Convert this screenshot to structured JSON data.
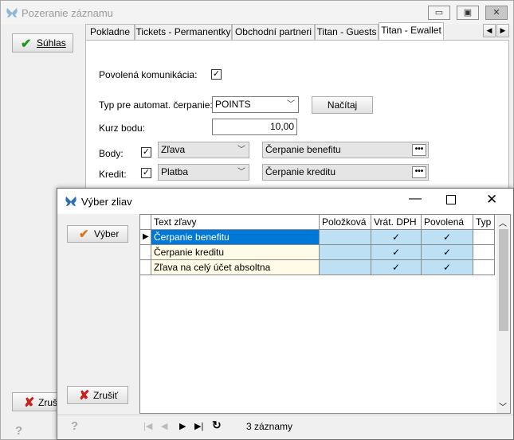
{
  "back": {
    "title": "Pozeranie záznamu",
    "ok_label": "Súhlas",
    "cancel_label": "Zruši",
    "tabs": [
      {
        "label": "Pokladne"
      },
      {
        "label": "Tickets - Permanentky"
      },
      {
        "label": "Obchodní partneri"
      },
      {
        "label": "Titan - Guests"
      },
      {
        "label": "Titan - Ewallet"
      }
    ],
    "form": {
      "allowed_comm_label": "Povolená komunikácia:",
      "type_label": "Typ pre automat. čerpanie:",
      "type_value": "POINTS",
      "load_button": "Načítaj",
      "rate_label": "Kurz bodu:",
      "rate_value": "10,00",
      "points_label": "Body:",
      "points_combo": "Zľava",
      "points_value": "Čerpanie benefitu",
      "credit_label": "Kredit:",
      "credit_combo": "Platba",
      "credit_value": "Čerpanie kreditu"
    }
  },
  "dialog": {
    "title": "Výber zliav",
    "select_button": "Výber",
    "cancel_button": "Zrušiť",
    "columns": [
      "Text zľavy",
      "Položková",
      "Vrát. DPH",
      "Povolená",
      "Typ"
    ],
    "rows": [
      {
        "text": "Čerpanie benefitu",
        "item": "",
        "vat": "✓",
        "allowed": "✓",
        "type": ""
      },
      {
        "text": "Čerpanie kreditu",
        "item": "",
        "vat": "✓",
        "allowed": "✓",
        "type": ""
      },
      {
        "text": "Zľava na celý účet absoltna",
        "item": "",
        "vat": "✓",
        "allowed": "✓",
        "type": ""
      }
    ],
    "record_count": "3 záznamy"
  },
  "colors": {
    "selection": "#0078d7",
    "checked_cell": "#bde0f5",
    "row_bg": "#fffbe7"
  }
}
